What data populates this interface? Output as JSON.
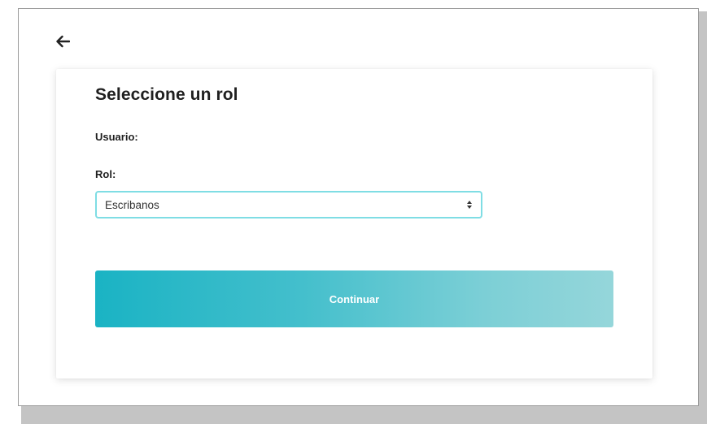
{
  "header": {
    "back_icon": "arrow-left-icon"
  },
  "card": {
    "title": "Seleccione un rol",
    "user_label": "Usuario:",
    "role_label": "Rol:",
    "role_select": {
      "selected": "Escribanos",
      "icon": "select-arrows-icon"
    },
    "continue_label": "Continuar"
  },
  "colors": {
    "select_border": "#7fdde4",
    "button_gradient_start": "#1ab3c4",
    "button_gradient_end": "#95d6da",
    "button_text": "#ffffff"
  }
}
